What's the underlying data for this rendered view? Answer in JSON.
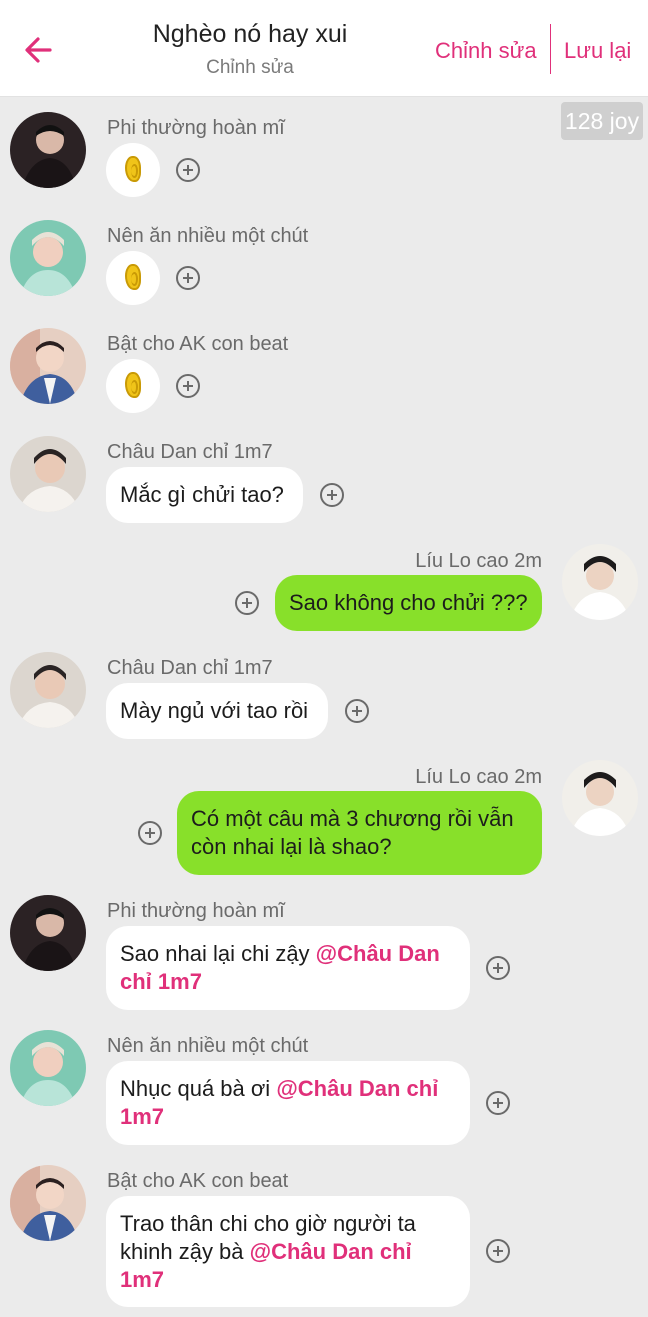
{
  "header": {
    "title": "Nghèo nó hay xui",
    "subtitle": "Chỉnh sửa",
    "edit_label": "Chỉnh sửa",
    "save_label": "Lưu lại"
  },
  "joy_badge": "128 joy",
  "colors": {
    "accent": "#e0307a",
    "green_bubble": "#88e02a",
    "background": "#ebebeb"
  },
  "messages": [
    {
      "sender": "Phi thường hoàn mĩ",
      "type": "icon",
      "icon": "ear-icon"
    },
    {
      "sender": "Nên ăn nhiều một chút",
      "type": "icon",
      "icon": "ear-icon"
    },
    {
      "sender": "Bật cho AK con beat",
      "type": "icon",
      "icon": "ear-icon"
    },
    {
      "sender": "Châu Dan chỉ 1m7",
      "type": "text",
      "text": "Mắc gì chửi tao?"
    },
    {
      "sender": "Líu Lo cao 2m",
      "type": "text",
      "side": "right",
      "text": "Sao không cho chửi ???"
    },
    {
      "sender": "Châu Dan chỉ 1m7",
      "type": "text",
      "text": "Mày ngủ với tao rồi"
    },
    {
      "sender": "Líu Lo cao 2m",
      "type": "text",
      "side": "right",
      "text_line1": "Có một câu mà 3 chương rồi vẫn",
      "text_line2": "còn nhai lại là shao?"
    },
    {
      "sender": "Phi thường hoàn mĩ",
      "type": "text",
      "text": "Sao nhai lại chi zậy ",
      "mention_a": "@Châu Dan",
      "mention_b": "chỉ 1m7"
    },
    {
      "sender": "Nên ăn nhiều một chút",
      "type": "text",
      "text": "Nhục quá bà ơi ",
      "mention_a": "@Châu Dan chỉ",
      "mention_b": "1m7"
    },
    {
      "sender": "Bật cho AK con beat",
      "type": "text",
      "text_line1": "Trao thân chi cho giờ người ta",
      "text_line2": "khinh zậy bà ",
      "mention_a": "@Châu Dan chỉ",
      "mention_b": "1m7"
    }
  ]
}
